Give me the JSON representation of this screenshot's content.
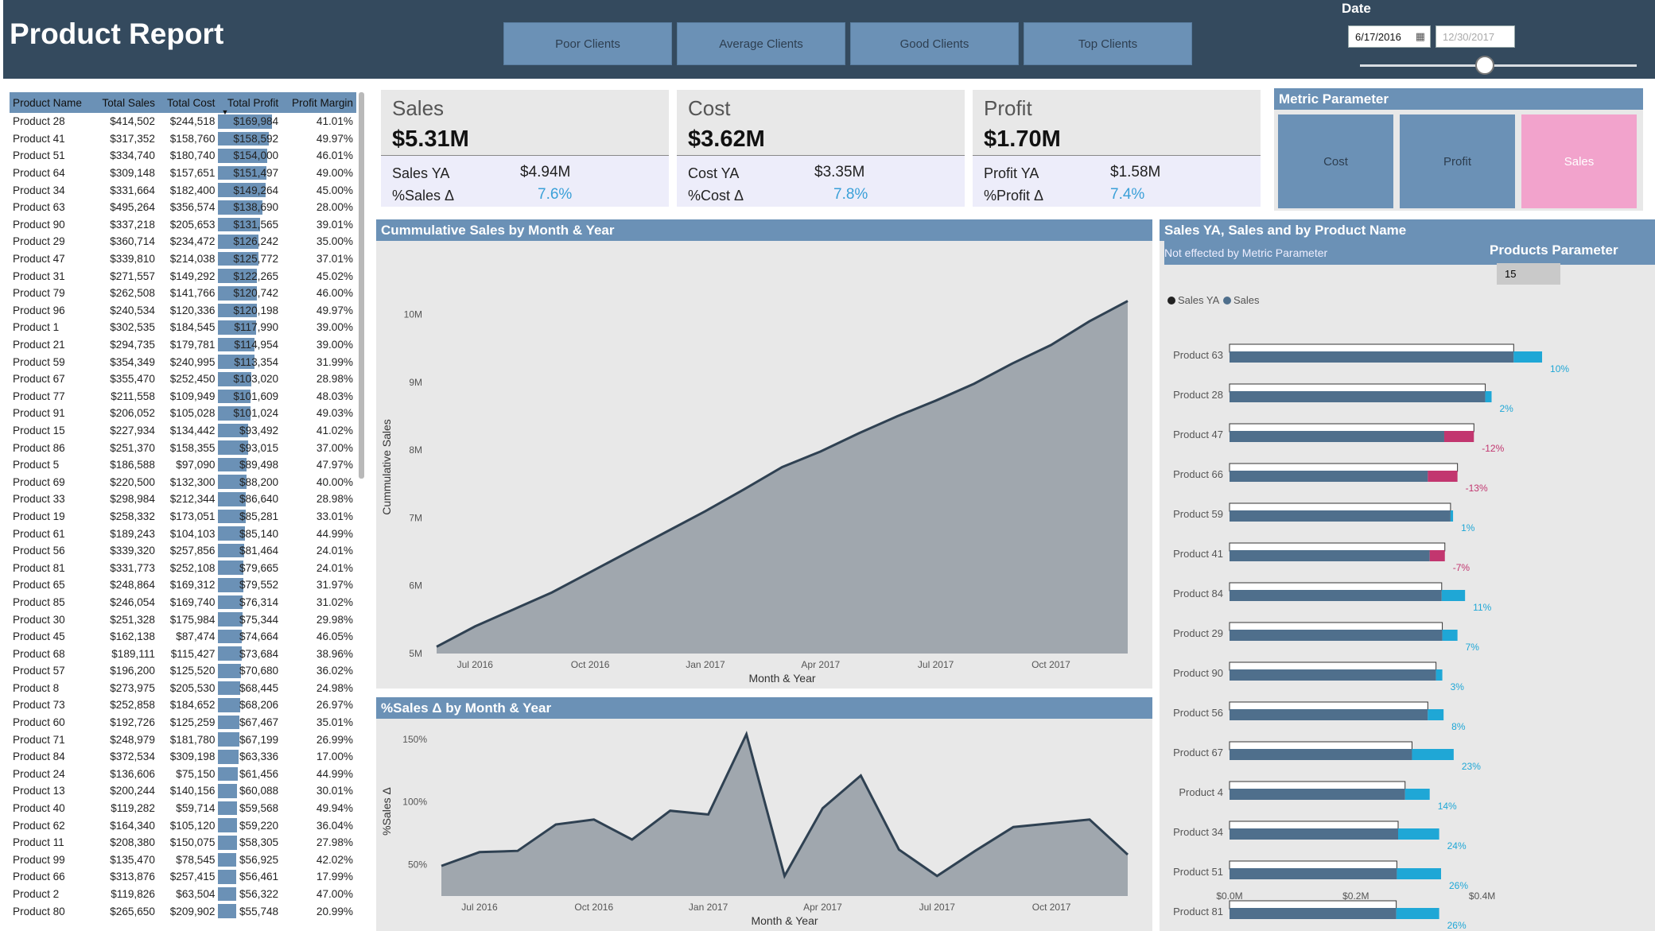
{
  "header": {
    "title": "Product Report",
    "segments": [
      "Poor Clients",
      "Average Clients",
      "Good Clients",
      "Top Clients"
    ],
    "date_label": "Date",
    "date_start": "6/17/2016",
    "date_end": "12/30/2017",
    "date_slider_position": 0.45
  },
  "table": {
    "columns": [
      "Product Name",
      "Total Sales",
      "Total Cost",
      "Total Profit",
      "Profit Margin"
    ],
    "rows": [
      [
        "Product 28",
        "$414,502",
        "$244,518",
        "$169,984",
        "41.01%"
      ],
      [
        "Product 41",
        "$317,352",
        "$158,760",
        "$158,592",
        "49.97%"
      ],
      [
        "Product 51",
        "$334,740",
        "$180,740",
        "$154,000",
        "46.01%"
      ],
      [
        "Product 64",
        "$309,148",
        "$157,651",
        "$151,497",
        "49.00%"
      ],
      [
        "Product 34",
        "$331,664",
        "$182,400",
        "$149,264",
        "45.00%"
      ],
      [
        "Product 63",
        "$495,264",
        "$356,574",
        "$138,690",
        "28.00%"
      ],
      [
        "Product 90",
        "$337,218",
        "$205,653",
        "$131,565",
        "39.01%"
      ],
      [
        "Product 29",
        "$360,714",
        "$234,472",
        "$126,242",
        "35.00%"
      ],
      [
        "Product 47",
        "$339,810",
        "$214,038",
        "$125,772",
        "37.01%"
      ],
      [
        "Product 31",
        "$271,557",
        "$149,292",
        "$122,265",
        "45.02%"
      ],
      [
        "Product 79",
        "$262,508",
        "$141,766",
        "$120,742",
        "46.00%"
      ],
      [
        "Product 96",
        "$240,534",
        "$120,336",
        "$120,198",
        "49.97%"
      ],
      [
        "Product 1",
        "$302,535",
        "$184,545",
        "$117,990",
        "39.00%"
      ],
      [
        "Product 21",
        "$294,735",
        "$179,781",
        "$114,954",
        "39.00%"
      ],
      [
        "Product 59",
        "$354,349",
        "$240,995",
        "$113,354",
        "31.99%"
      ],
      [
        "Product 67",
        "$355,470",
        "$252,450",
        "$103,020",
        "28.98%"
      ],
      [
        "Product 77",
        "$211,558",
        "$109,949",
        "$101,609",
        "48.03%"
      ],
      [
        "Product 91",
        "$206,052",
        "$105,028",
        "$101,024",
        "49.03%"
      ],
      [
        "Product 15",
        "$227,934",
        "$134,442",
        "$93,492",
        "41.02%"
      ],
      [
        "Product 86",
        "$251,370",
        "$158,355",
        "$93,015",
        "37.00%"
      ],
      [
        "Product 5",
        "$186,588",
        "$97,090",
        "$89,498",
        "47.97%"
      ],
      [
        "Product 69",
        "$220,500",
        "$132,300",
        "$88,200",
        "40.00%"
      ],
      [
        "Product 33",
        "$298,984",
        "$212,344",
        "$86,640",
        "28.98%"
      ],
      [
        "Product 19",
        "$258,332",
        "$173,051",
        "$85,281",
        "33.01%"
      ],
      [
        "Product 61",
        "$189,243",
        "$104,103",
        "$85,140",
        "44.99%"
      ],
      [
        "Product 56",
        "$339,320",
        "$257,856",
        "$81,464",
        "24.01%"
      ],
      [
        "Product 81",
        "$331,773",
        "$252,108",
        "$79,665",
        "24.01%"
      ],
      [
        "Product 65",
        "$248,864",
        "$169,312",
        "$79,552",
        "31.97%"
      ],
      [
        "Product 85",
        "$246,054",
        "$169,740",
        "$76,314",
        "31.02%"
      ],
      [
        "Product 30",
        "$251,328",
        "$175,984",
        "$75,344",
        "29.98%"
      ],
      [
        "Product 45",
        "$162,138",
        "$87,474",
        "$74,664",
        "46.05%"
      ],
      [
        "Product 68",
        "$189,111",
        "$115,427",
        "$73,684",
        "38.96%"
      ],
      [
        "Product 57",
        "$196,200",
        "$125,520",
        "$70,680",
        "36.02%"
      ],
      [
        "Product 8",
        "$273,975",
        "$205,530",
        "$68,445",
        "24.98%"
      ],
      [
        "Product 73",
        "$252,858",
        "$184,652",
        "$68,206",
        "26.97%"
      ],
      [
        "Product 60",
        "$192,726",
        "$125,259",
        "$67,467",
        "35.01%"
      ],
      [
        "Product 71",
        "$248,979",
        "$181,780",
        "$67,199",
        "26.99%"
      ],
      [
        "Product 84",
        "$372,534",
        "$309,198",
        "$63,336",
        "17.00%"
      ],
      [
        "Product 24",
        "$136,606",
        "$75,150",
        "$61,456",
        "44.99%"
      ],
      [
        "Product 13",
        "$200,244",
        "$140,156",
        "$60,088",
        "30.01%"
      ],
      [
        "Product 40",
        "$119,282",
        "$59,714",
        "$59,568",
        "49.94%"
      ],
      [
        "Product 62",
        "$164,340",
        "$105,120",
        "$59,220",
        "36.04%"
      ],
      [
        "Product 11",
        "$208,380",
        "$150,075",
        "$58,305",
        "27.98%"
      ],
      [
        "Product 99",
        "$135,470",
        "$78,545",
        "$56,925",
        "42.02%"
      ],
      [
        "Product 66",
        "$313,876",
        "$257,415",
        "$56,461",
        "17.99%"
      ],
      [
        "Product 2",
        "$119,826",
        "$63,504",
        "$56,322",
        "47.00%"
      ],
      [
        "Product 80",
        "$265,650",
        "$209,902",
        "$55,748",
        "20.99%"
      ]
    ]
  },
  "cards": [
    {
      "title": "Sales",
      "value": "$5.31M",
      "ya_label": "Sales YA",
      "ya_value": "$4.94M",
      "pct_label": "%Sales Δ",
      "pct_value": "7.6%"
    },
    {
      "title": "Cost",
      "value": "$3.62M",
      "ya_label": "Cost YA",
      "ya_value": "$3.35M",
      "pct_label": "%Cost Δ",
      "pct_value": "7.8%"
    },
    {
      "title": "Profit",
      "value": "$1.70M",
      "ya_label": "Profit YA",
      "ya_value": "$1.58M",
      "pct_label": "%Profit Δ",
      "pct_value": "7.4%"
    }
  ],
  "metric_parameter": {
    "title": "Metric Parameter",
    "options": [
      "Cost",
      "Profit",
      "Sales"
    ],
    "selected": "Sales",
    "selected_color": "#f2a3cc",
    "default_color": "#6b91b6"
  },
  "chart_data": [
    {
      "type": "area",
      "title": "Cummulative Sales by Month & Year",
      "xlabel": "Month & Year",
      "ylabel": "Cummulative Sales",
      "x_ticks": [
        "Jul 2016",
        "Oct 2016",
        "Jan 2017",
        "Apr 2017",
        "Jul 2017",
        "Oct 2017"
      ],
      "y_ticks": [
        "5M",
        "6M",
        "7M",
        "8M",
        "9M",
        "10M"
      ],
      "ylim": [
        5,
        10.5
      ],
      "x": [
        "Jun 2016",
        "Jul 2016",
        "Aug 2016",
        "Sep 2016",
        "Oct 2016",
        "Nov 2016",
        "Dec 2016",
        "Jan 2017",
        "Feb 2017",
        "Mar 2017",
        "Apr 2017",
        "May 2017",
        "Jun 2017",
        "Jul 2017",
        "Aug 2017",
        "Sep 2017",
        "Oct 2017",
        "Nov 2017",
        "Dec 2017"
      ],
      "values": [
        5.1,
        5.4,
        5.65,
        5.9,
        6.2,
        6.5,
        6.8,
        7.1,
        7.42,
        7.75,
        7.98,
        8.25,
        8.5,
        8.73,
        8.98,
        9.28,
        9.55,
        9.9,
        10.2
      ]
    },
    {
      "type": "area",
      "title": "%Sales Δ by Month & Year",
      "xlabel": "Month & Year",
      "ylabel": "%Sales Δ",
      "x_ticks": [
        "Jul 2016",
        "Oct 2016",
        "Jan 2017",
        "Apr 2017",
        "Jul 2017",
        "Oct 2017"
      ],
      "y_ticks": [
        "50%",
        "100%",
        "150%"
      ],
      "ylim": [
        25,
        160
      ],
      "x": [
        "Jun 2016",
        "Jul 2016",
        "Aug 2016",
        "Sep 2016",
        "Oct 2016",
        "Nov 2016",
        "Dec 2016",
        "Jan 2017",
        "Feb 2017",
        "Mar 2017",
        "Apr 2017",
        "May 2017",
        "Jun 2017",
        "Jul 2017",
        "Aug 2017",
        "Sep 2017",
        "Oct 2017",
        "Nov 2017",
        "Dec 2017"
      ],
      "values": [
        49,
        60,
        61,
        82,
        86,
        70,
        93,
        90,
        154,
        41,
        95,
        121,
        62,
        41,
        61,
        80,
        83,
        86,
        58
      ]
    },
    {
      "type": "bar",
      "title": "Sales YA, Sales and by Product Name",
      "subtitle": "Not effected by Metric Parameter",
      "legend": [
        "Sales YA",
        "Sales"
      ],
      "legend_colors": [
        "#222222",
        "#4f6f8c"
      ],
      "categories": [
        "Product 63",
        "Product 28",
        "Product 47",
        "Product 66",
        "Product 59",
        "Product 41",
        "Product 84",
        "Product 29",
        "Product 90",
        "Product 56",
        "Product 67",
        "Product 4",
        "Product 34",
        "Product 51",
        "Product 81"
      ],
      "series": [
        {
          "name": "Sales YA",
          "values": [
            0.45,
            0.405,
            0.387,
            0.361,
            0.35,
            0.341,
            0.336,
            0.337,
            0.327,
            0.314,
            0.289,
            0.278,
            0.267,
            0.265,
            0.264
          ]
        },
        {
          "name": "Sales",
          "values": [
            0.495,
            0.415,
            0.34,
            0.314,
            0.354,
            0.317,
            0.373,
            0.361,
            0.337,
            0.339,
            0.355,
            0.317,
            0.332,
            0.335,
            0.332
          ]
        }
      ],
      "pct_labels": [
        "10%",
        "2%",
        "-12%",
        "-13%",
        "1%",
        "-7%",
        "11%",
        "7%",
        "3%",
        "8%",
        "23%",
        "14%",
        "24%",
        "26%",
        "26%"
      ],
      "x_ticks": [
        "$0.0M",
        "$0.2M",
        "$0.4M"
      ],
      "xlim": [
        0,
        0.5
      ],
      "positive_color": "#1fa7d6",
      "negative_color": "#c2366f"
    }
  ],
  "products_parameter": {
    "title": "Products Parameter",
    "value": "15"
  }
}
